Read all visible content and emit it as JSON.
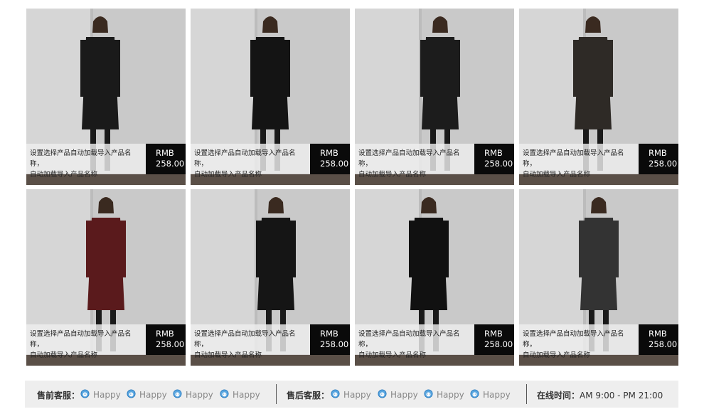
{
  "products": [
    {
      "name_line1": "设置选择产品自动加载导入产品名称，",
      "name_line2": "自动加载导入产品名称",
      "currency": "RMB",
      "price": "258.00",
      "coat_color": "#1a1a1a"
    },
    {
      "name_line1": "设置选择产品自动加载导入产品名称，",
      "name_line2": "自动加载导入产品名称",
      "currency": "RMB",
      "price": "258.00",
      "coat_color": "#141414"
    },
    {
      "name_line1": "设置选择产品自动加载导入产品名称，",
      "name_line2": "自动加载导入产品名称",
      "currency": "RMB",
      "price": "258.00",
      "coat_color": "#1c1c1c"
    },
    {
      "name_line1": "设置选择产品自动加载导入产品名称，",
      "name_line2": "自动加载导入产品名称",
      "currency": "RMB",
      "price": "258.00",
      "coat_color": "#2e2a26"
    },
    {
      "name_line1": "设置选择产品自动加载导入产品名称，",
      "name_line2": "自动加载导入产品名称",
      "currency": "RMB",
      "price": "258.00",
      "coat_color": "#5a1a1c"
    },
    {
      "name_line1": "设置选择产品自动加载导入产品名称，",
      "name_line2": "自动加载导入产品名称",
      "currency": "RMB",
      "price": "258.00",
      "coat_color": "#151515"
    },
    {
      "name_line1": "设置选择产品自动加载导入产品名称，",
      "name_line2": "自动加载导入产品名称",
      "currency": "RMB",
      "price": "258.00",
      "coat_color": "#111111"
    },
    {
      "name_line1": "设置选择产品自动加载导入产品名称，",
      "name_line2": "自动加载导入产品名称",
      "currency": "RMB",
      "price": "258.00",
      "coat_color": "#333333"
    }
  ],
  "footer": {
    "presale_label": "售前客服：",
    "presale_agents": [
      "Happy",
      "Happy",
      "Happy",
      "Happy"
    ],
    "aftersale_label": "售后客服：",
    "aftersale_agents": [
      "Happy",
      "Happy",
      "Happy",
      "Happy"
    ],
    "hours_label": "在线时间：",
    "hours_value": "AM 9:00 - PM 21:00",
    "chat_icon": "chat-bubble-icon"
  }
}
